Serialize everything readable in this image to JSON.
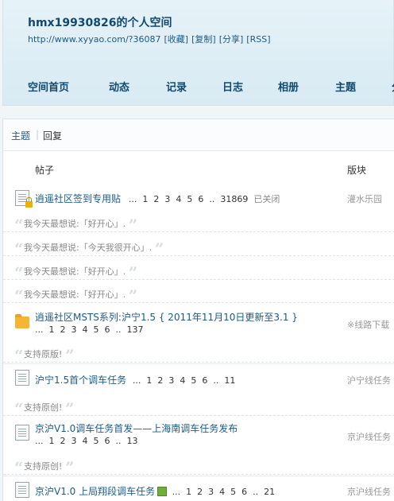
{
  "header": {
    "title": "hmx19930826的个人空间",
    "url": "http://www.xyyao.com/?36087",
    "links": [
      "[收藏]",
      "[复制]",
      "[分享]",
      "[RSS]"
    ]
  },
  "nav": [
    "空间首页",
    "动态",
    "记录",
    "日志",
    "相册",
    "主题",
    "分"
  ],
  "tabs": {
    "topic": "主题",
    "reply": "回复"
  },
  "columns": {
    "post": "帖子",
    "board": "版块"
  },
  "threads": [
    {
      "title": "逍遥社区签到专用贴",
      "pages": [
        "...",
        "1",
        "2",
        "3",
        "4",
        "5",
        "6",
        "..",
        "31869"
      ],
      "status": "已关闭",
      "board": "灌水乐园"
    },
    {
      "title": "逍遥社区MSTS系列:沪宁1.5 { 2011年11月10日更新至3.1 }",
      "pages": [
        "...",
        "1",
        "2",
        "3",
        "4",
        "5",
        "6",
        "..",
        "137"
      ],
      "board": "※线路下载"
    },
    {
      "title": "沪宁1.5首个调车任务",
      "pages": [
        "...",
        "1",
        "2",
        "3",
        "4",
        "5",
        "6",
        "..",
        "11"
      ],
      "board": "沪宁线任务"
    },
    {
      "title": "京沪V1.0调车任务首发——上海南调车任务发布",
      "pages": [
        "...",
        "1",
        "2",
        "3",
        "4",
        "5",
        "6",
        "..",
        "13"
      ],
      "board": "京沪线任务"
    },
    {
      "title": "京沪V1.0 上局翔段调车任务",
      "pages": [
        "...",
        "1",
        "2",
        "3",
        "4",
        "5",
        "6",
        "..",
        "21"
      ],
      "board": "京沪线任务"
    }
  ],
  "quotes": [
    "我今天最想说:「好开心」.",
    "我今天最想说:「今天我很开心」.",
    "我今天最想说:「好开心」.",
    "我今天最想说:「好开心」.",
    "支持原版!",
    "支持原创!",
    "支持原创!"
  ],
  "quote_marks": {
    "open": "“",
    "close": "”"
  }
}
